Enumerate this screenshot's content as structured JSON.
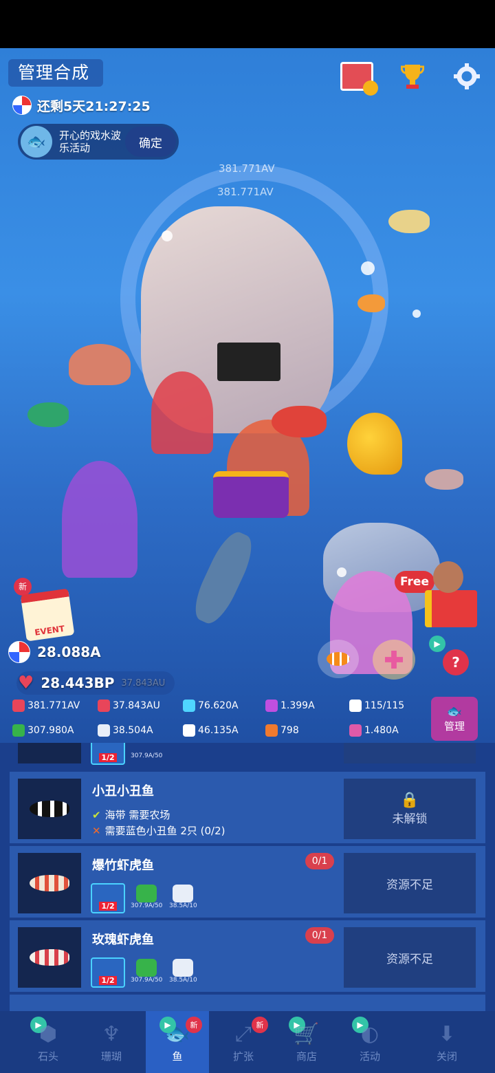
{
  "header": {
    "title": "管理合成",
    "countdown": "还剩5天21:27:25",
    "event_name": "开心的戏水波乐活动",
    "event_confirm": "确定",
    "floating_av_1": "381.771AV",
    "floating_av_2": "381.771AV"
  },
  "side_badges": {
    "new_label": "新",
    "event_label": "EVENT",
    "free_label": "Free"
  },
  "resources": {
    "main_a": "28.088A",
    "main_bp": "28.443BP",
    "main_bp_sub": "37.843AU",
    "stats_row1": [
      {
        "icon": "hand-heart-icon",
        "value": "381.771AV",
        "color": "#e8455a"
      },
      {
        "icon": "heart-info-icon",
        "value": "37.843AU",
        "color": "#e8455a"
      },
      {
        "icon": "diamond-icon",
        "value": "76.620A",
        "color": "#4fd5ff"
      },
      {
        "icon": "pearl-icon",
        "value": "1.399A",
        "color": "#c04fe0"
      },
      {
        "icon": "fish-count-icon",
        "value": "115/115",
        "color": "#ffffff"
      }
    ],
    "stats_row2": [
      {
        "icon": "seaweed-icon",
        "value": "307.980A",
        "color": "#37b34a"
      },
      {
        "icon": "shell-icon",
        "value": "38.504A",
        "color": "#e8eef8"
      },
      {
        "icon": "urchin-icon",
        "value": "46.135A",
        "color": "#ffffff"
      },
      {
        "icon": "shrimp-icon",
        "value": "798",
        "color": "#f07a2e"
      },
      {
        "icon": "seahorse-icon",
        "value": "1.480A",
        "color": "#e05aa8"
      }
    ],
    "manage_label": "管理"
  },
  "fish_list": {
    "prev_row_stat": "307.9A/50",
    "prev_row_level": "1/2",
    "rows": [
      {
        "name": "小丑小丑鱼",
        "req_ok": "海带 需要农场",
        "req_fail": "需要蓝色小丑鱼 2只 (0/2)",
        "action": "未解锁"
      },
      {
        "name": "爆竹虾虎鱼",
        "count": "0/1",
        "level": "1/2",
        "cost1": "307.9A/50",
        "cost2": "38.5A/10",
        "action": "资源不足"
      },
      {
        "name": "玫瑰虾虎鱼",
        "count": "0/1",
        "level": "1/2",
        "cost1": "307.9A/50",
        "cost2": "38.5A/10",
        "action": "资源不足"
      }
    ]
  },
  "tabs": [
    {
      "label": "石头"
    },
    {
      "label": "珊瑚"
    },
    {
      "label": "鱼"
    },
    {
      "label": "扩张"
    },
    {
      "label": "商店"
    },
    {
      "label": "活动"
    },
    {
      "label": "关闭"
    }
  ],
  "badges": {
    "new": "新"
  }
}
